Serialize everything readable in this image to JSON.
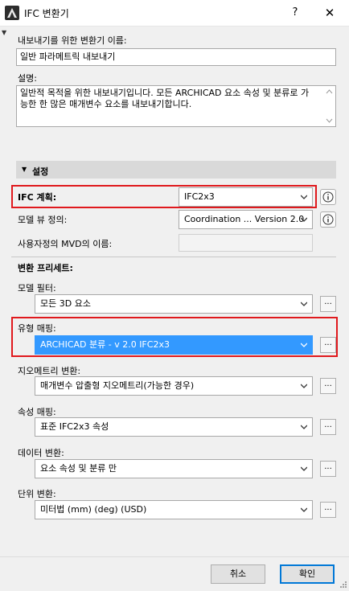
{
  "window": {
    "title": "IFC 변환기",
    "help_label": "?",
    "close_label": "✕"
  },
  "name_field": {
    "label": "내보내기를 위한 변환기 이름:",
    "value": "일반 파라메트릭 내보내기"
  },
  "description": {
    "label": "설명:",
    "text": "일반적 목적을 위한 내보내기입니다. 모든 ARCHICAD 요소 속성 및 분류로 가능한 한 많은 매개변수 요소를 내보내기합니다."
  },
  "settings": {
    "header": "설정",
    "ifc_scheme": {
      "label": "IFC 계획:",
      "value": "IFC2x3"
    },
    "model_view": {
      "label": "모델 뷰 정의:",
      "value": "Coordination ... Version 2.0"
    },
    "custom_mvd": {
      "label": "사용자정의 MVD의 이름:",
      "value": ""
    }
  },
  "presets": {
    "header": "변환 프리세트:",
    "items": [
      {
        "label": "모델 필터:",
        "value": "모든 3D 요소"
      },
      {
        "label": "유형 매핑:",
        "value": "ARCHICAD 분류 - v 2.0 IFC2x3"
      },
      {
        "label": "지오메트리 변환:",
        "value": "매개변수 압출형 지오메트리(가능한 경우)"
      },
      {
        "label": "속성 매핑:",
        "value": "표준 IFC2x3 속성"
      },
      {
        "label": "데이터 변환:",
        "value": "요소 속성 및 분류 만"
      },
      {
        "label": "단위 변환:",
        "value": "미터법 (mm) (deg) (USD)"
      }
    ],
    "more_label": "..."
  },
  "footer": {
    "cancel_label": "취소",
    "ok_label": "확인"
  }
}
